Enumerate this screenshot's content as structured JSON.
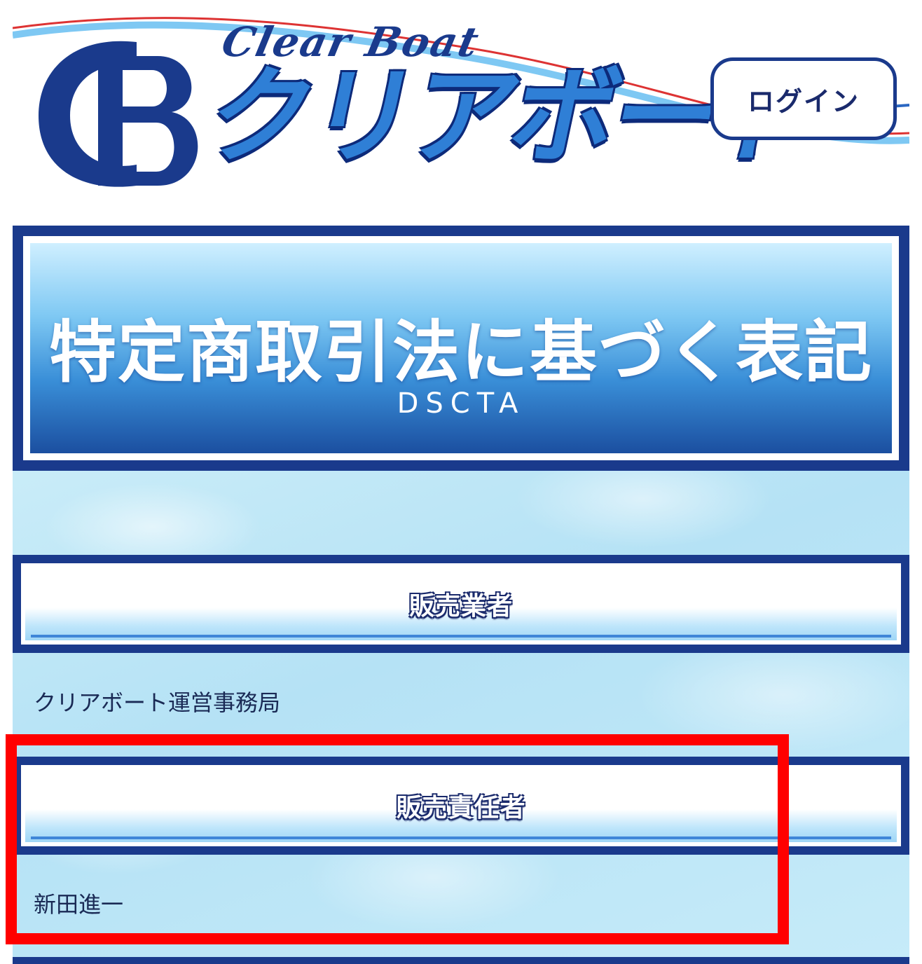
{
  "header": {
    "logo_monogram": "CB",
    "logo_script": "Clear Boat",
    "logo_kana": "クリアボート",
    "login_label": "ログイン"
  },
  "banner": {
    "title": "特定商取引法に基づく表記",
    "subtitle": "DSCTA"
  },
  "sections": [
    {
      "heading": "販売業者",
      "value": "クリアボート運営事務局"
    },
    {
      "heading": "販売責任者",
      "value": "新田進一"
    }
  ],
  "colors": {
    "brand_navy": "#1a3a8c",
    "accent_blue": "#2f7fd6",
    "highlight_red": "#ff0000"
  }
}
